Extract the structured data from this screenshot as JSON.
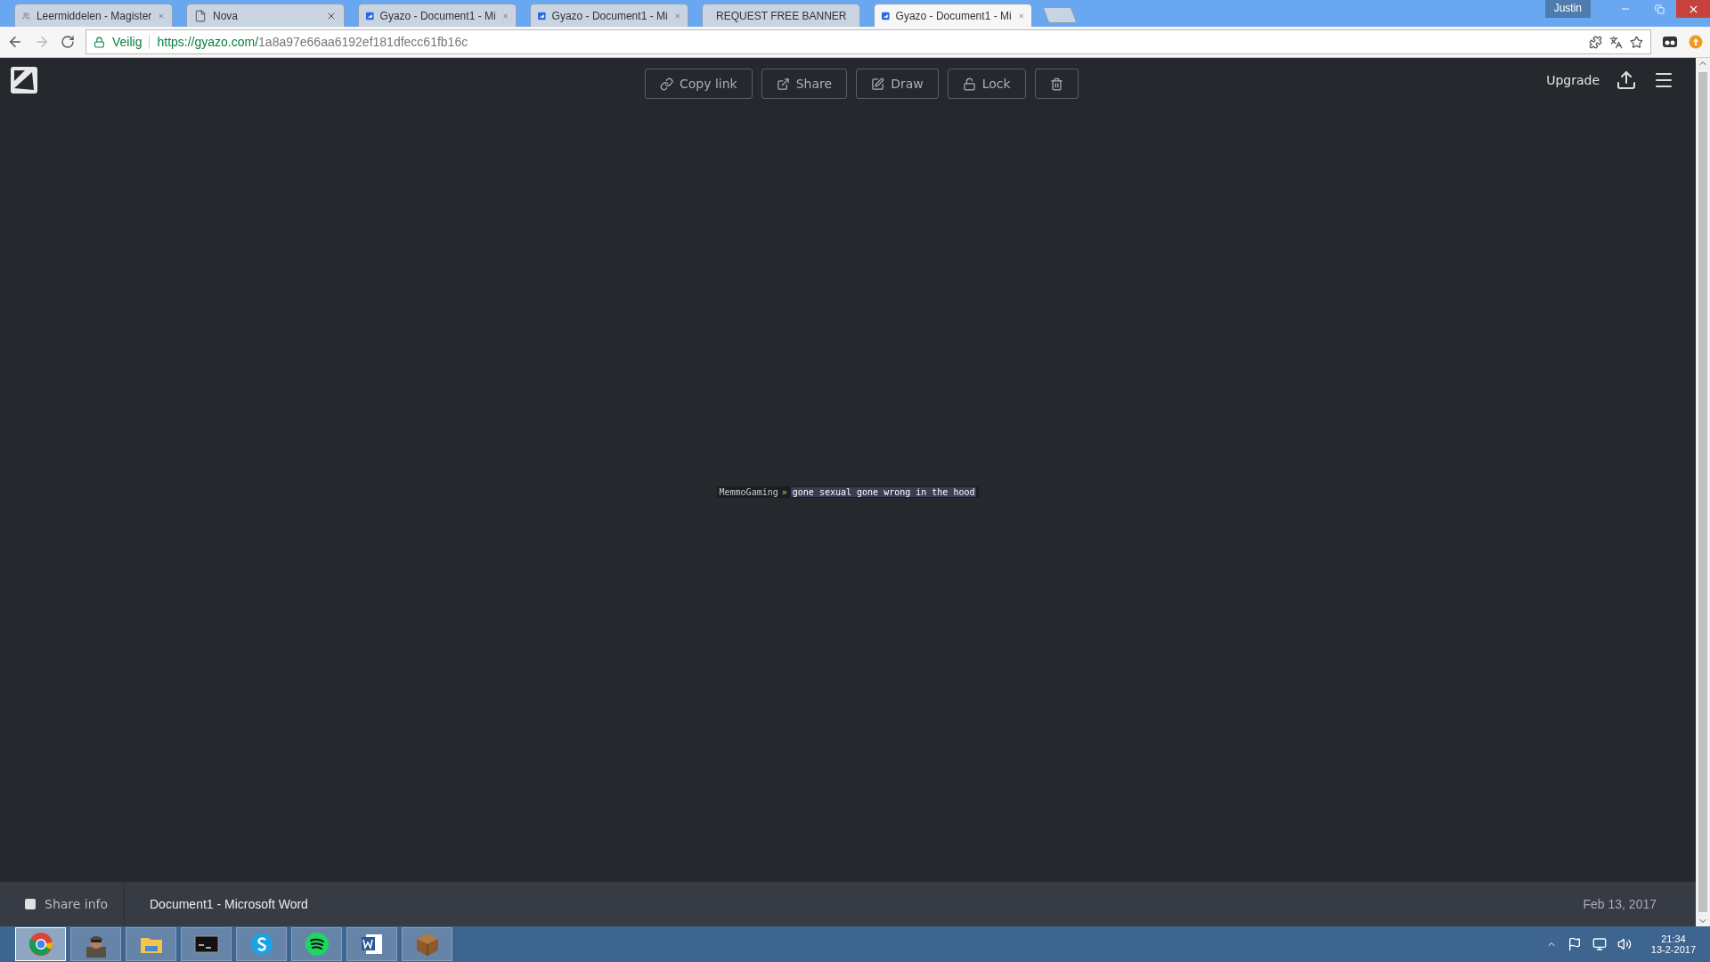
{
  "browser": {
    "tabs": [
      {
        "kind": "people",
        "title": "Leermiddelen - Magister",
        "selected": false
      },
      {
        "kind": "page",
        "title": "Nova",
        "selected": false
      },
      {
        "kind": "gyazo",
        "title": "Gyazo - Document1 - Mi",
        "selected": false
      },
      {
        "kind": "gyazo",
        "title": "Gyazo - Document1 - Mi",
        "selected": false
      },
      {
        "kind": "banner",
        "title": "REQUEST FREE BANNER",
        "selected": false
      },
      {
        "kind": "gyazo",
        "title": "Gyazo - Document1 - Mi",
        "selected": true
      }
    ],
    "profile": "Justin",
    "address": {
      "secure_label": "Veilig",
      "url_host": "https://gyazo.com/",
      "url_path": "1a8a97e66aa6192ef181dfecc61fb16c"
    }
  },
  "toolbar": {
    "buttons": [
      {
        "kind": "link",
        "label": "Copy link"
      },
      {
        "kind": "share",
        "label": "Share"
      },
      {
        "kind": "draw",
        "label": "Draw"
      },
      {
        "kind": "lock",
        "label": "Lock"
      },
      {
        "kind": "delete"
      }
    ],
    "upgrade": "Upgrade"
  },
  "image": {
    "sender": "MemmoGaming",
    "separator": "»",
    "message": "gone sexual gone wrong in the hood"
  },
  "footer": {
    "share_info": {
      "label": "Share info",
      "checked": false
    },
    "title": "Document1 - Microsoft Word",
    "date": "Feb 13, 2017"
  },
  "taskbar": {
    "apps": [
      {
        "kind": "chrome",
        "selected": true
      },
      {
        "kind": "soldier",
        "selected": false
      },
      {
        "kind": "folder",
        "selected": false
      },
      {
        "kind": "terminal",
        "selected": false
      },
      {
        "kind": "skype",
        "selected": false
      },
      {
        "kind": "spotify",
        "selected": false
      },
      {
        "kind": "word",
        "selected": false
      },
      {
        "kind": "crate",
        "selected": false
      }
    ],
    "time": "21:34",
    "date": "13-2-2017"
  }
}
